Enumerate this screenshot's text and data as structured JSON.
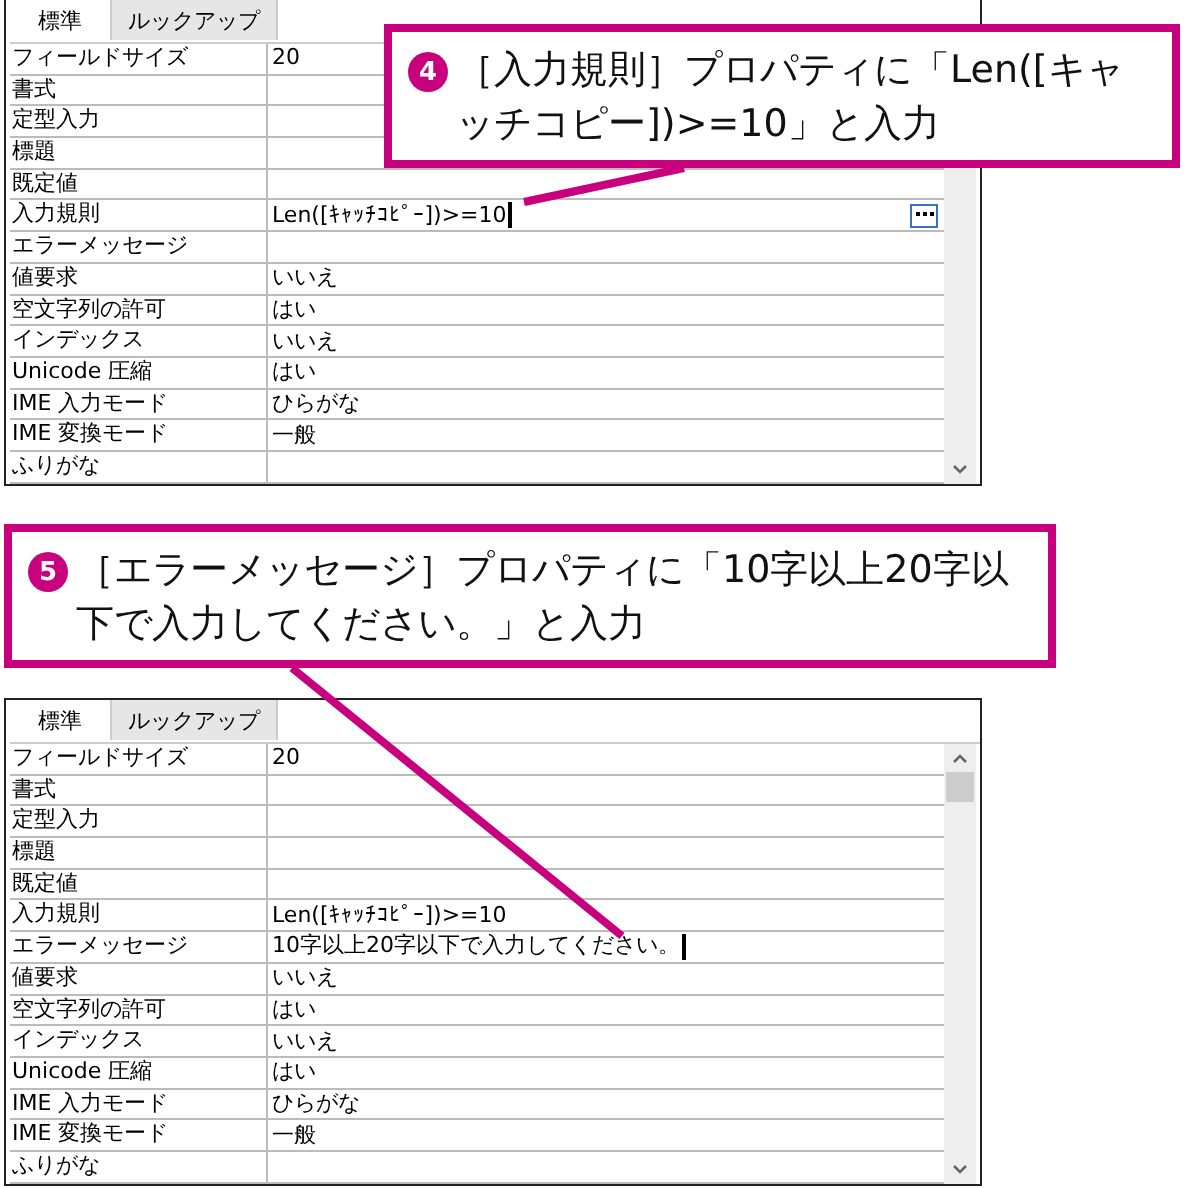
{
  "panels": [
    {
      "tabs": [
        {
          "label": "標準",
          "selected": true
        },
        {
          "label": "ルックアップ",
          "selected": false
        }
      ],
      "rows": [
        {
          "name": "フィールドサイズ",
          "value": "20",
          "editing": false
        },
        {
          "name": "書式",
          "value": "",
          "editing": false
        },
        {
          "name": "定型入力",
          "value": "",
          "editing": false
        },
        {
          "name": "標題",
          "value": "",
          "editing": false
        },
        {
          "name": "既定値",
          "value": "",
          "editing": false,
          "builder": false
        },
        {
          "name": "入力規則",
          "value": "Len([ｷｬｯﾁｺﾋﾟｰ])>=10",
          "editing": true,
          "builder": true
        },
        {
          "name": "エラーメッセージ",
          "value": "",
          "editing": false,
          "builder": false
        },
        {
          "name": "値要求",
          "value": "いいえ",
          "editing": false,
          "builder": false
        },
        {
          "name": "空文字列の許可",
          "value": "はい",
          "editing": false,
          "builder": false
        },
        {
          "name": "インデックス",
          "value": "いいえ",
          "editing": false,
          "builder": false
        },
        {
          "name": "Unicode 圧縮",
          "value": "はい",
          "editing": false,
          "builder": false
        },
        {
          "name": "IME 入力モード",
          "value": "ひらがな",
          "editing": false,
          "builder": false
        },
        {
          "name": "IME 変換モード",
          "value": "一般",
          "editing": false,
          "builder": false
        },
        {
          "name": "ふりがな",
          "value": "",
          "editing": false,
          "builder": false
        }
      ]
    },
    {
      "tabs": [
        {
          "label": "標準",
          "selected": true
        },
        {
          "label": "ルックアップ",
          "selected": false
        }
      ],
      "rows": [
        {
          "name": "フィールドサイズ",
          "value": "20",
          "editing": false,
          "builder": false
        },
        {
          "name": "書式",
          "value": "",
          "editing": false,
          "builder": false
        },
        {
          "name": "定型入力",
          "value": "",
          "editing": false,
          "builder": false
        },
        {
          "name": "標題",
          "value": "",
          "editing": false,
          "builder": false
        },
        {
          "name": "既定値",
          "value": "",
          "editing": false,
          "builder": false
        },
        {
          "name": "入力規則",
          "value": "Len([ｷｬｯﾁｺﾋﾟｰ])>=10",
          "editing": false,
          "builder": false
        },
        {
          "name": "エラーメッセージ",
          "value": "10字以上20字以下で入力してください。",
          "editing": true,
          "builder": false
        },
        {
          "name": "値要求",
          "value": "いいえ",
          "editing": false,
          "builder": false
        },
        {
          "name": "空文字列の許可",
          "value": "はい",
          "editing": false,
          "builder": false
        },
        {
          "name": "インデックス",
          "value": "いいえ",
          "editing": false,
          "builder": false
        },
        {
          "name": "Unicode 圧縮",
          "value": "はい",
          "editing": false,
          "builder": false
        },
        {
          "name": "IME 入力モード",
          "value": "ひらがな",
          "editing": false,
          "builder": false
        },
        {
          "name": "IME 変換モード",
          "value": "一般",
          "editing": false,
          "builder": false
        },
        {
          "name": "ふりがな",
          "value": "",
          "editing": false,
          "builder": false
        }
      ]
    }
  ],
  "callouts": [
    {
      "number": "4",
      "text": "［入力規則］プロパティに「Len([キャッチコピー])>=10」と入力"
    },
    {
      "number": "5",
      "text": "［エラーメッセージ］プロパティに「10字以上20字以下で入力してください。」と入力"
    }
  ]
}
